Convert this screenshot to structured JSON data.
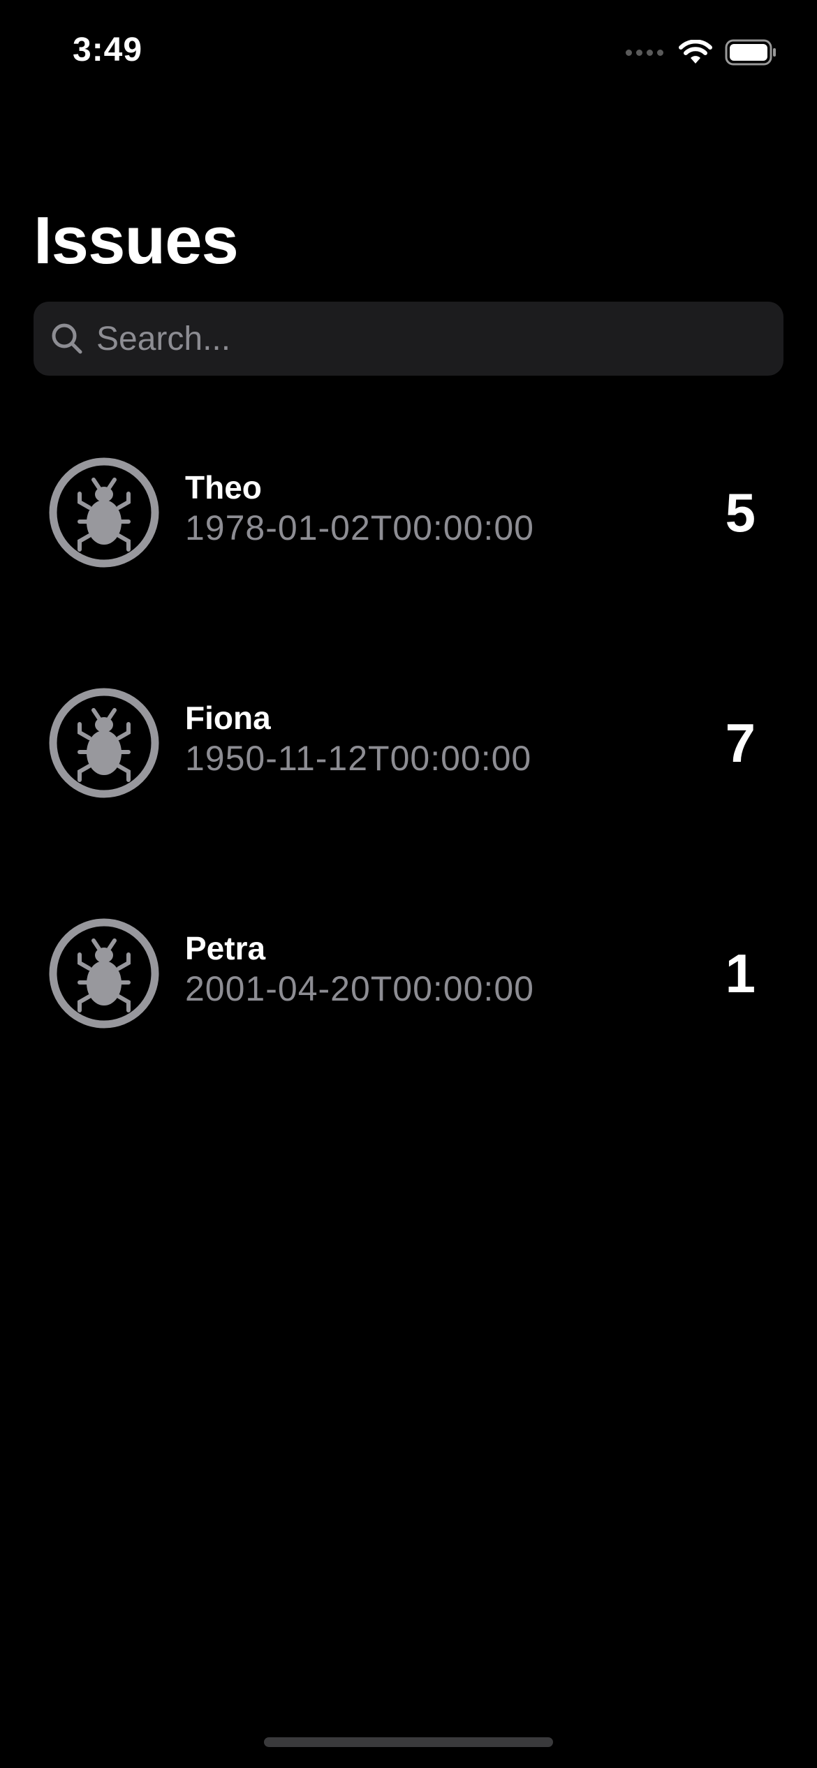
{
  "status_bar": {
    "time": "3:49"
  },
  "header": {
    "title": "Issues"
  },
  "search": {
    "placeholder": "Search...",
    "value": ""
  },
  "issues": [
    {
      "name": "Theo",
      "date": "1978-01-02T00:00:00",
      "count": "5",
      "icon": "bug-icon"
    },
    {
      "name": "Fiona",
      "date": "1950-11-12T00:00:00",
      "count": "7",
      "icon": "bug-icon"
    },
    {
      "name": "Petra",
      "date": "2001-04-20T00:00:00",
      "count": "1",
      "icon": "bug-icon"
    }
  ],
  "colors": {
    "background": "#000000",
    "search_background": "#1c1c1e",
    "secondary_text": "#8d8d93",
    "icon_gray": "#98989d",
    "primary_text": "#ffffff"
  }
}
